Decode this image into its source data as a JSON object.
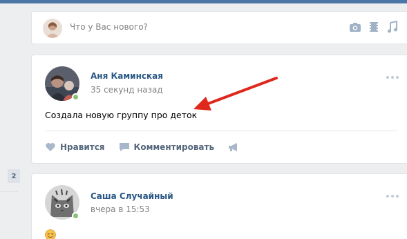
{
  "composer": {
    "placeholder": "Что у Вас нового?"
  },
  "sidebar": {
    "counter": "2"
  },
  "posts": [
    {
      "author": "Аня Каминская",
      "time": "35 секунд назад",
      "text": "Создала новую группу про деток",
      "actions": {
        "like": "Нравится",
        "comment": "Комментировать"
      }
    },
    {
      "author": "Саша Случайный",
      "time": "вчера в 15:53",
      "emoji": "😌"
    }
  ],
  "colors": {
    "accent": "#2a5885",
    "online": "#8ac176",
    "arrow": "#e0271c"
  }
}
